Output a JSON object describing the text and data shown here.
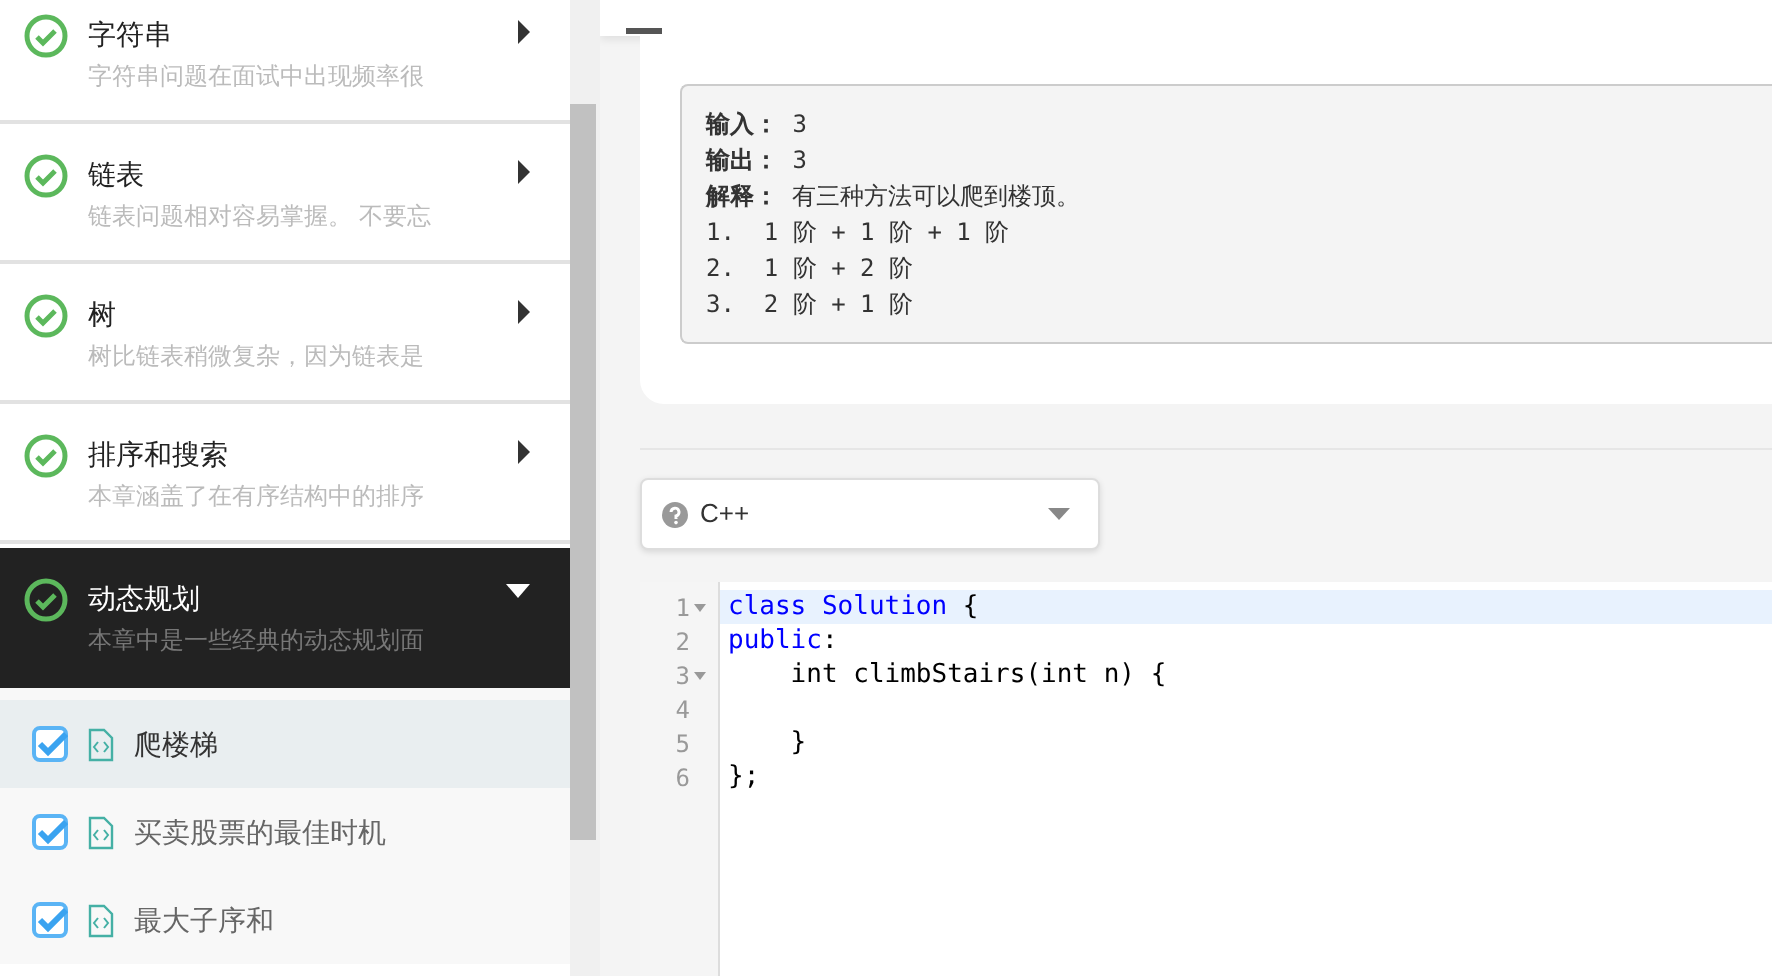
{
  "chapters": [
    {
      "title": "字符串",
      "description": "字符串问题在面试中出现频率很",
      "completed": true,
      "expanded": false
    },
    {
      "title": "链表",
      "description": "链表问题相对容易掌握。 不要忘",
      "completed": true,
      "expanded": false
    },
    {
      "title": "树",
      "description": "树比链表稍微复杂，因为链表是",
      "completed": true,
      "expanded": false
    },
    {
      "title": "排序和搜索",
      "description": "本章涵盖了在有序结构中的排序",
      "completed": true,
      "expanded": false
    },
    {
      "title": "动态规划",
      "description": "本章中是一些经典的动态规划面",
      "completed": true,
      "expanded": true,
      "items": [
        {
          "title": "爬楼梯",
          "checked": true,
          "selected": true
        },
        {
          "title": "买卖股票的最佳时机",
          "checked": true,
          "selected": false
        },
        {
          "title": "最大子序和",
          "checked": true,
          "selected": false
        }
      ]
    }
  ],
  "example": {
    "lines": [
      "**输入：** 3",
      "**输出：** 3",
      "**解释：** 有三种方法可以爬到楼顶。",
      "1.  1 阶 + 1 阶 + 1 阶",
      "2.  1 阶 + 2 阶",
      "3.  2 阶 + 1 阶"
    ]
  },
  "language_select": {
    "value": "C++"
  },
  "editor": {
    "lines": [
      {
        "number": "1",
        "foldable": true,
        "active": true,
        "tokens": [
          {
            "kind": "keyword",
            "text": "class"
          },
          {
            "kind": "type",
            "text": " Solution"
          },
          {
            "kind": "plain",
            "text": " {"
          }
        ]
      },
      {
        "number": "2",
        "foldable": false,
        "active": false,
        "tokens": [
          {
            "kind": "keyword",
            "text": "public"
          },
          {
            "kind": "plain",
            "text": ":"
          }
        ]
      },
      {
        "number": "3",
        "foldable": true,
        "active": false,
        "tokens": [
          {
            "kind": "plain",
            "text": "    int climbStairs(int n) {"
          }
        ]
      },
      {
        "number": "4",
        "foldable": false,
        "active": false
      },
      {
        "number": "5",
        "foldable": false,
        "active": false,
        "tokens": [
          {
            "kind": "plain",
            "text": "    }"
          }
        ]
      },
      {
        "number": "6",
        "foldable": false,
        "active": false,
        "tokens": [
          {
            "kind": "plain",
            "text": "};"
          }
        ]
      }
    ]
  }
}
